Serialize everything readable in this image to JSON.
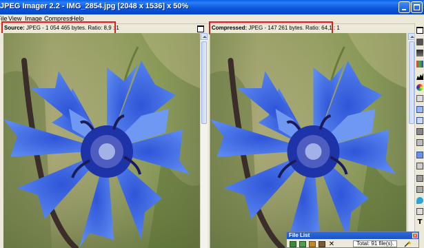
{
  "window": {
    "title": "JPEG Imager 2.2 - IMG_2854.jpg [2048 x 1536] x 50%"
  },
  "menu": {
    "items": [
      "File",
      "View",
      "Image",
      "Compress",
      "Help"
    ]
  },
  "source_panel": {
    "label": "Source:",
    "info": " JPEG - 1 054 465 bytes. Ratio: 8,9 : 1"
  },
  "compressed_panel": {
    "label": "Compressed:",
    "info": " JPEG - 147 261 bytes. Ratio: 64,1 : 1"
  },
  "file_list": {
    "title": "File List",
    "count": "Total: 91 file(s)."
  },
  "colors": {
    "highlight": "#e01a1a",
    "titlebar": "#0b58dc",
    "flower": "#3f6fe6"
  },
  "icons": [
    "minimize-icon",
    "maximize-icon",
    "panel-window-icon",
    "close-icon",
    "magic-wand-icon"
  ]
}
